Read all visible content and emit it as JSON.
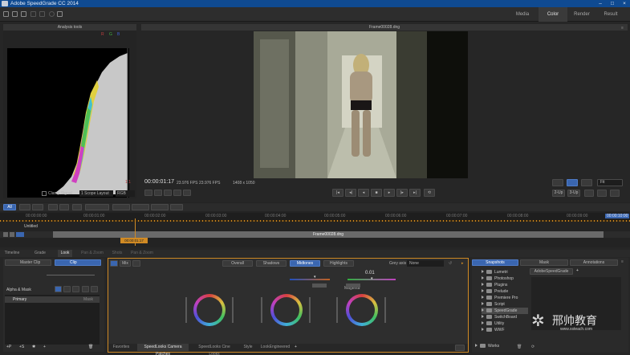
{
  "app": {
    "title": "Adobe SpeedGrade CC 2014"
  },
  "modes": [
    {
      "label": "Media"
    },
    {
      "label": "Color"
    },
    {
      "label": "Render"
    },
    {
      "label": "Result"
    }
  ],
  "scope": {
    "title": "Analysis tools",
    "clamp_label": "Clamp Signal",
    "layout_value": "1 Scope Layout",
    "type_value": "RGB"
  },
  "viewer": {
    "filename": "Frame00028.dng",
    "timecode": "00:00:01:17",
    "fps_primary": "23.976 FPS",
    "fps_secondary": "23.976 FPS",
    "resolution": "1408 x 1050",
    "fit_label": "Fit",
    "layout_a": "2-Up",
    "layout_b": "3-Up"
  },
  "timeline": {
    "mode_all": "All",
    "track_name": "Untitled",
    "clip_name": "Frame00028.dng",
    "playhead_tc": "00:00:01:17",
    "ruler_ticks": [
      "00:00:00:00",
      "00:00:01:00",
      "00:00:02:00",
      "00:00:03:00",
      "00:00:04:00",
      "00:00:05:00",
      "00:00:06:00",
      "00:00:07:00",
      "00:00:08:00",
      "00:00:09:00",
      "00:00:10:00"
    ],
    "badge_right": "00:00:10:00"
  },
  "panel_tabs": [
    "Timeline",
    "Grade",
    "Look",
    "Pan & Zoom",
    "Shots",
    "Pan & Zoom"
  ],
  "layers": {
    "master_clip": "Master Clip",
    "clip": "Clip",
    "alpha_mask": "Alpha & Mask",
    "primary": "Primary",
    "mask_label": "Mask"
  },
  "grade": {
    "fx_label": "Mix",
    "tabs": [
      "Overall",
      "Shadows",
      "Midtones",
      "Highlights"
    ],
    "active_tab": "Midtones",
    "grey_axis_label": "Grey axis",
    "grey_axis_value": "None",
    "magenta_value": "0.01",
    "magenta_label": "Magenta"
  },
  "bottom_tabs": [
    "Favorites",
    "SpeedLooks Camera Patches",
    "SpeedLooks Cine Looks",
    "Style",
    "LookEngineered"
  ],
  "bottom_active": "SpeedLooks Camera Patches",
  "browser": {
    "tabs": [
      "Snapshots",
      "Mask",
      "Annotations"
    ],
    "header_label": "AdobeSpeedGrade",
    "folders": [
      "Lumetri",
      "Photoshop",
      "Plugins",
      "Prelude",
      "Premiere Pro",
      "Script",
      "SpeedGrade",
      "SwitchBoard",
      "Utility",
      "WWF",
      "Works"
    ],
    "selected": "SpeedGrade"
  },
  "watermark": {
    "brand": "邢帅教育",
    "url": "www.xsteach.com"
  },
  "colors": {
    "titlebar": "#0f4a91",
    "accent_orange": "#d08a24",
    "active_blue": "#3a66b0"
  }
}
